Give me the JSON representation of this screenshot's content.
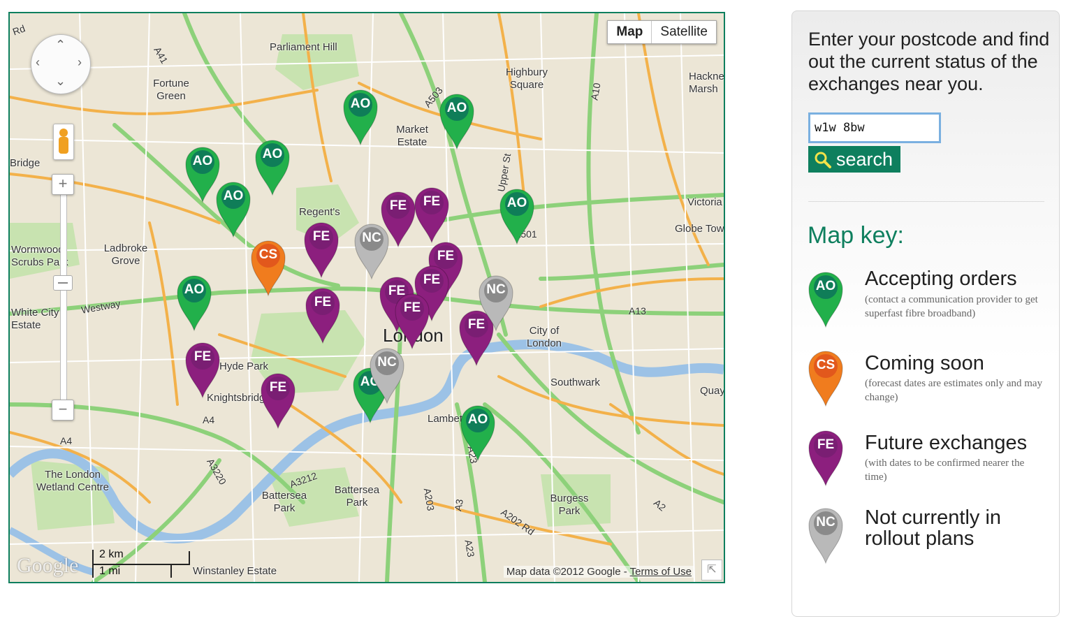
{
  "map": {
    "type_controls": {
      "map": "Map",
      "satellite": "Satellite"
    },
    "scale": {
      "km": "2 km",
      "mi": "1 mi"
    },
    "logo": "Google",
    "attribution": {
      "text": "Map data ©2012 Google - ",
      "terms": "Terms of Use"
    },
    "city_label": "London",
    "places": [
      "Parliament Hill",
      "Fortune Green",
      "Highbury Square",
      "Market Estate",
      "Regent's",
      "Wormwood Scrubs Park",
      "Ladbroke Grove",
      "White City Estate",
      "Westway",
      "Hyde Park",
      "Knightsbridge",
      "City of London",
      "Southwark",
      "Lambeth",
      "Battersea Park",
      "Battersea Park",
      "The London Wetland Centre",
      "Burgess Park",
      "Winstanley Estate",
      "Victoria",
      "Globe Town",
      "Hackney Marsh",
      "Bridge",
      "Quay",
      "Upper St"
    ],
    "roads": [
      "A41",
      "A503",
      "A10",
      "A501",
      "A13",
      "A4",
      "A4",
      "A3220",
      "A3212",
      "A203",
      "A3",
      "A23",
      "A202 Rd",
      "A23",
      "A2",
      "Rd"
    ],
    "pins": [
      {
        "code": "AO",
        "status": "accepting"
      },
      {
        "code": "AO",
        "status": "accepting"
      },
      {
        "code": "AO",
        "status": "accepting"
      },
      {
        "code": "AO",
        "status": "accepting"
      },
      {
        "code": "AO",
        "status": "accepting"
      },
      {
        "code": "AO",
        "status": "accepting"
      },
      {
        "code": "AO",
        "status": "accepting"
      },
      {
        "code": "AO",
        "status": "accepting"
      },
      {
        "code": "AO",
        "status": "accepting"
      },
      {
        "code": "CS",
        "status": "coming"
      },
      {
        "code": "FE",
        "status": "future"
      },
      {
        "code": "FE",
        "status": "future"
      },
      {
        "code": "FE",
        "status": "future"
      },
      {
        "code": "FE",
        "status": "future"
      },
      {
        "code": "FE",
        "status": "future"
      },
      {
        "code": "FE",
        "status": "future"
      },
      {
        "code": "FE",
        "status": "future"
      },
      {
        "code": "FE",
        "status": "future"
      },
      {
        "code": "FE",
        "status": "future"
      },
      {
        "code": "FE",
        "status": "future"
      },
      {
        "code": "FE",
        "status": "future"
      },
      {
        "code": "NC",
        "status": "not"
      },
      {
        "code": "NC",
        "status": "not"
      },
      {
        "code": "NC",
        "status": "not"
      }
    ]
  },
  "panel": {
    "intro": "Enter your postcode and find out the current status of the exchanges near you.",
    "postcode_value": "w1w 8bw",
    "search_label": "search",
    "key_title": "Map key:",
    "key": [
      {
        "code": "AO",
        "name": "Accepting orders",
        "note": "(contact a communication provider to get superfast fibre broadband)"
      },
      {
        "code": "CS",
        "name": "Coming soon",
        "note": "(forecast dates are estimates only and may change)"
      },
      {
        "code": "FE",
        "name": "Future exchanges",
        "note": "(with dates to be confirmed nearer the time)"
      },
      {
        "code": "NC",
        "name": "Not currently in rollout plans",
        "note": ""
      }
    ]
  },
  "colors": {
    "accepting": "#22b04b",
    "accepting_inner": "#0f7d58",
    "coming": "#f07c1e",
    "coming_inner": "#e2581c",
    "future": "#8c1f7e",
    "future_inner": "#7a1e73",
    "not": "#b9b9b9",
    "not_inner": "#8a8a8a",
    "brand": "#0e7f5e"
  }
}
